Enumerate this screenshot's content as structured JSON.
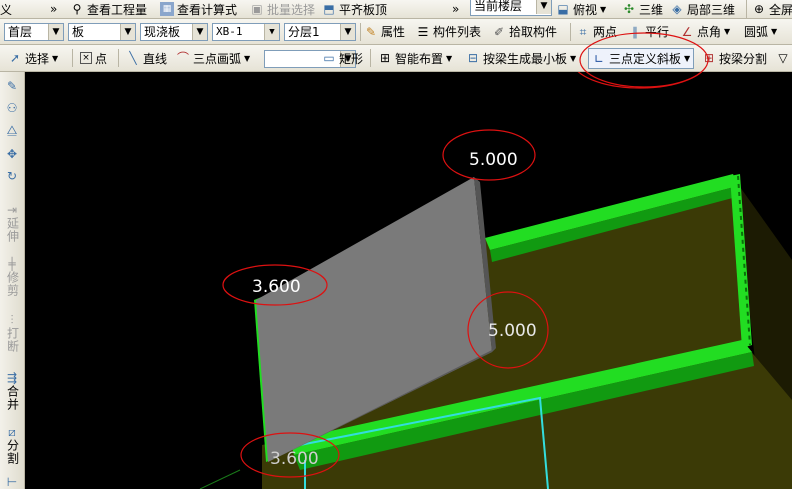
{
  "row1": {
    "menu_fragment": "义",
    "chevron1": "»",
    "view_quantity": "查看工程量",
    "view_formula": "查看计算式",
    "batch_select": "批量选择",
    "flush_slab_top": "平齐板顶",
    "chevron2": "»",
    "current_floor": "当前楼层",
    "top_view": "俯视",
    "three_d": "三维",
    "local_3d": "局部三维",
    "fullscreen": "全屏"
  },
  "row2": {
    "floor_select": "首层",
    "type_select": "板",
    "subtype_select": "现浇板",
    "component_select": "XB-1",
    "layer_select": "分层1",
    "properties": "属性",
    "component_list": "构件列表",
    "pick_component": "拾取构件",
    "two_points": "两点",
    "parallel": "平行",
    "point_angle": "点角",
    "arc": "圆弧"
  },
  "row3": {
    "select": "选择",
    "point": "点",
    "line": "直线",
    "three_point_arc": "三点画弧",
    "blank_select": "",
    "rectangle": "矩形",
    "smart_layout": "智能布置",
    "min_slab_by_beam": "按梁生成最小板",
    "three_point_slope": "三点定义斜板",
    "split_by_beam": "按梁分割"
  },
  "left_toolbar": {
    "extend": "延伸",
    "trim": "修剪",
    "break": "打断",
    "merge": "合并",
    "split": "分割"
  },
  "canvas": {
    "elevation_top": "5.000",
    "elevation_left": "3.600",
    "elevation_right": "5.000",
    "elevation_bottom": "3.600"
  },
  "colors": {
    "beam_green": "#22dd22",
    "slab_grey": "#7a7a7a",
    "annotation_red": "#dd1111",
    "axis_cyan": "#33dddd",
    "floor_olive": "#3b3a06"
  }
}
